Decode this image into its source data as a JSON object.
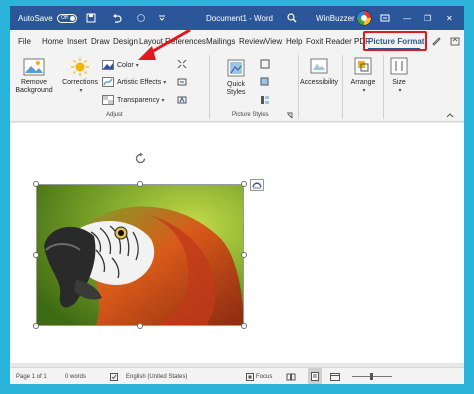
{
  "titlebar": {
    "autosave_label": "AutoSave",
    "autosave_state": "Off",
    "doc_title": "Document1 - Word",
    "user_name": "WinBuzzer",
    "minimize_glyph": "—",
    "restore_glyph": "❐",
    "close_glyph": "✕"
  },
  "tabs": [
    {
      "label": "File"
    },
    {
      "label": "Home"
    },
    {
      "label": "Insert"
    },
    {
      "label": "Draw"
    },
    {
      "label": "Design"
    },
    {
      "label": "Layout"
    },
    {
      "label": "References"
    },
    {
      "label": "Mailings"
    },
    {
      "label": "Review"
    },
    {
      "label": "View"
    },
    {
      "label": "Help"
    },
    {
      "label": "Foxit Reader PDF"
    },
    {
      "label": "Picture Format"
    }
  ],
  "ribbon": {
    "remove_background": "Remove\nBackground",
    "corrections": "Corrections",
    "color": "Color",
    "artistic_effects": "Artistic Effects",
    "transparency": "Transparency",
    "adjust_group": "Adjust",
    "quick_styles": "Quick\nStyles",
    "picture_styles_group": "Picture Styles",
    "accessibility": "Accessibility",
    "arrange": "Arrange",
    "size": "Size",
    "dropdown_glyph": "▾"
  },
  "statusbar": {
    "page": "Page 1 of 1",
    "words": "0 words",
    "language": "English (United States)",
    "focus": "Focus"
  },
  "colors": {
    "word_blue": "#2b579a",
    "highlight_red": "#e0191f"
  }
}
